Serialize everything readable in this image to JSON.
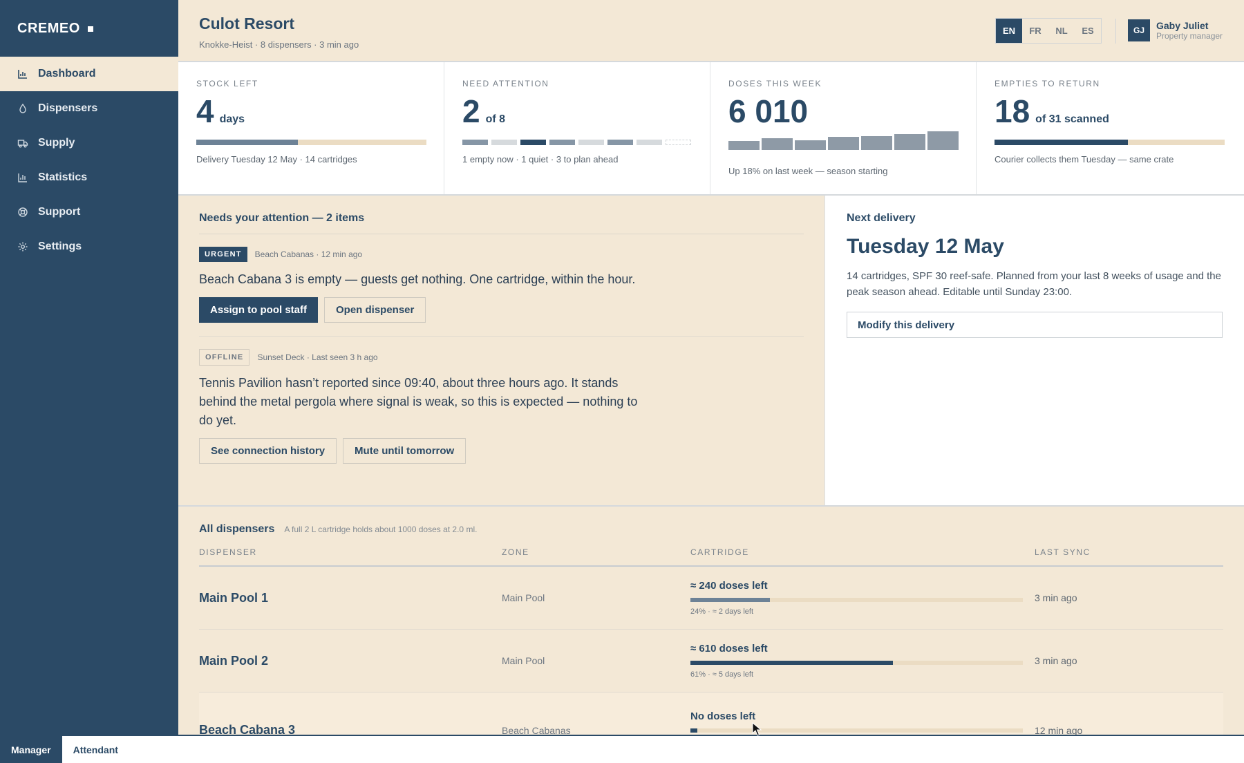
{
  "app": {
    "brand": "CREMEO"
  },
  "sidebar": {
    "items": [
      {
        "label": "Dashboard",
        "icon": "chart-icon",
        "active": true
      },
      {
        "label": "Dispensers",
        "icon": "droplet-icon",
        "active": false
      },
      {
        "label": "Supply",
        "icon": "truck-icon",
        "active": false
      },
      {
        "label": "Statistics",
        "icon": "bar-chart-icon",
        "active": false
      },
      {
        "label": "Support",
        "icon": "lifebuoy-icon",
        "active": false
      },
      {
        "label": "Settings",
        "icon": "gear-icon",
        "active": false
      }
    ]
  },
  "header": {
    "title": "Culot Resort",
    "subtitle": "Knokke-Heist · 8 dispensers · 3 min ago",
    "languages": [
      "EN",
      "FR",
      "NL",
      "ES"
    ],
    "active_language": "EN",
    "user": {
      "initials": "GJ",
      "name": "Gaby Juliet",
      "role": "Property manager"
    }
  },
  "kpis": {
    "stock": {
      "label": "STOCK LEFT",
      "value": "4",
      "unit": "days",
      "fill_fraction": 0.44,
      "foot": "Delivery Tuesday 12 May · 14 cartridges"
    },
    "attention": {
      "label": "NEED ATTENTION",
      "value": "2",
      "unit": "of 8",
      "foot": "1 empty now · 1 quiet · 3 to plan ahead",
      "segments": [
        "medium",
        "light",
        "dark",
        "medium",
        "light",
        "medium",
        "light",
        "empty"
      ]
    },
    "doses": {
      "label": "DOSES THIS WEEK",
      "value": "6 010",
      "foot": "Up 18% on last week — season starting",
      "daily_relative": [
        0.42,
        0.52,
        0.45,
        0.58,
        0.64,
        0.72,
        0.85
      ]
    },
    "empties": {
      "label": "EMPTIES TO RETURN",
      "value": "18",
      "unit": "of 31 scanned",
      "fill_fraction": 0.58,
      "foot": "Courier collects them Tuesday — same crate"
    }
  },
  "attention": {
    "title": "Needs your attention — 2 items",
    "alerts": [
      {
        "tag": "URGENT",
        "meta": "Beach Cabanas · 12 min ago",
        "text": "Beach Cabana 3 is empty — guests get nothing. One cartridge, within the hour.",
        "primary": "Assign to pool staff",
        "secondary": "Open dispenser"
      },
      {
        "tag": "OFFLINE",
        "meta": "Sunset Deck · Last seen 3 h ago",
        "text": "Tennis Pavilion hasn’t reported since 09:40, about three hours ago. It stands behind the metal pergola where signal is weak, so this is expected — nothing to do yet.",
        "primary": "See connection history",
        "secondary": "Mute until tomorrow"
      }
    ]
  },
  "delivery": {
    "title": "Next delivery",
    "date": "Tuesday 12 May",
    "text": "14 cartridges, SPF 30 reef-safe. Planned from your last 8 weeks of usage and the peak season ahead. Editable until Sunday 23:00.",
    "button": "Modify this delivery"
  },
  "table": {
    "title": "All dispensers",
    "note": "A full 2 L cartridge holds about 1000 doses at 2.0 ml.",
    "columns": [
      "DISPENSER",
      "ZONE",
      "CARTRIDGE",
      "LAST SYNC"
    ],
    "rows": [
      {
        "name": "Main Pool 1",
        "zone": "Main Pool",
        "cartridge": "≈ 240 doses left",
        "fill": 0.24,
        "detail": "24% · ≈ 2 days left",
        "sync": "3 min ago"
      },
      {
        "name": "Main Pool 2",
        "zone": "Main Pool",
        "cartridge": "≈ 610 doses left",
        "fill": 0.61,
        "detail": "61% · ≈ 5 days left",
        "sync": "3 min ago"
      },
      {
        "name": "Beach Cabana 3",
        "zone": "Beach Cabanas",
        "cartridge": "No doses left",
        "fill": 0.02,
        "detail": "",
        "sync": "12 min ago"
      }
    ]
  },
  "modes": {
    "manager": "Manager",
    "attendant": "Attendant",
    "active": "Manager"
  },
  "colors": {
    "navy": "#2b4a66",
    "sand": "#f3e8d6",
    "track": "#ebdcc3",
    "slate": "#6d8296"
  }
}
